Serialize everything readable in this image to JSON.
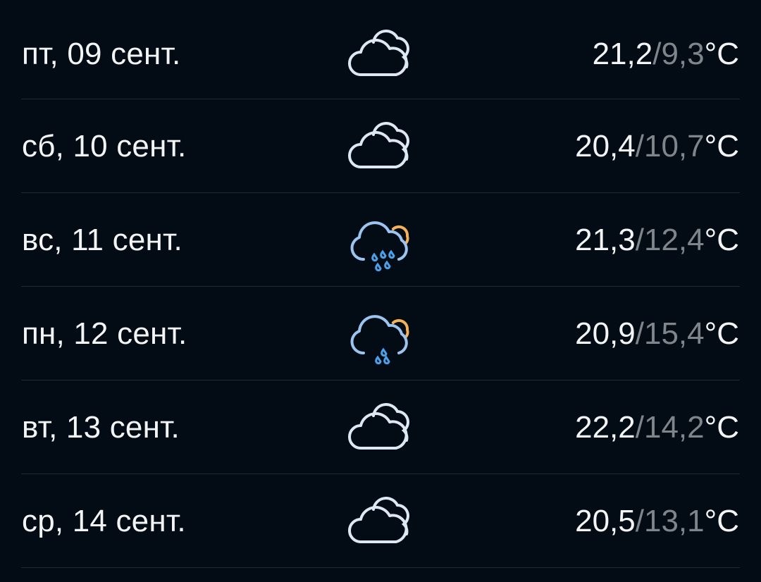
{
  "forecast": {
    "days": [
      {
        "date": "пт, 09 сент.",
        "icon": "cloudy-icon",
        "max": "21,2",
        "sep": "/",
        "min": "9,3",
        "unit": "°C"
      },
      {
        "date": "сб, 10 сент.",
        "icon": "cloudy-icon",
        "max": "20,4",
        "sep": "/",
        "min": "10,7",
        "unit": "°C"
      },
      {
        "date": "вс, 11 сент.",
        "icon": "heavy-rain-sun-icon",
        "max": "21,3",
        "sep": "/",
        "min": "12,4",
        "unit": "°C"
      },
      {
        "date": "пн, 12 сент.",
        "icon": "light-rain-sun-icon",
        "max": "20,9",
        "sep": "/",
        "min": "15,4",
        "unit": "°C"
      },
      {
        "date": "вт, 13 сент.",
        "icon": "cloudy-icon",
        "max": "22,2",
        "sep": "/",
        "min": "14,2",
        "unit": "°C"
      },
      {
        "date": "ср, 14 сент.",
        "icon": "cloudy-icon",
        "max": "20,5",
        "sep": "/",
        "min": "13,1",
        "unit": "°C"
      }
    ]
  },
  "colors": {
    "background": "#030c14",
    "text": "#f2f4f6",
    "min_temp": "#7e858b",
    "divider": "#1f2a34",
    "cloud_outline": "#dce8f3",
    "rain_cloud": "#9bc4f0",
    "rain_drops": "#4d9fe6",
    "sun_arc": "#f2b15a"
  }
}
